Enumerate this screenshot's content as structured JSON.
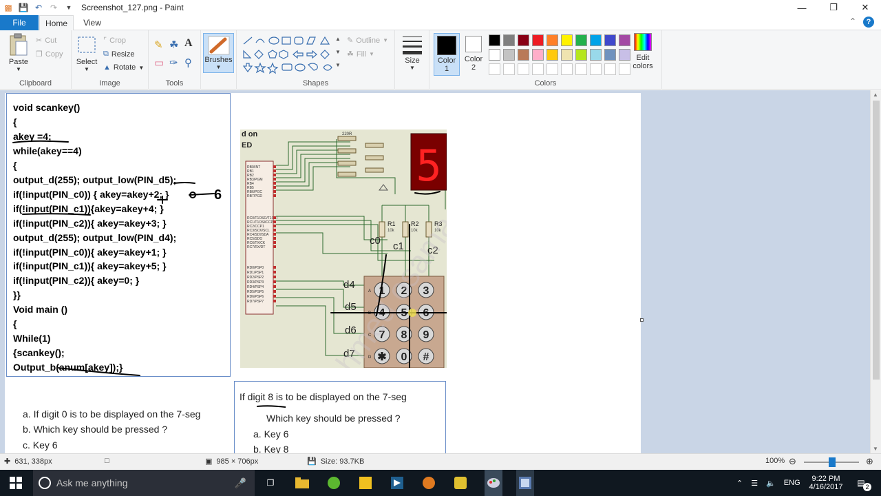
{
  "window": {
    "title": "Screenshot_127.png - Paint",
    "minimize": "—",
    "maximize": "❐",
    "close": "✕"
  },
  "tabs": {
    "file": "File",
    "home": "Home",
    "view": "View"
  },
  "ribbon": {
    "clipboard": {
      "label": "Clipboard",
      "paste": "Paste",
      "cut": "Cut",
      "copy": "Copy"
    },
    "image": {
      "label": "Image",
      "select": "Select",
      "crop": "Crop",
      "resize": "Resize",
      "rotate": "Rotate"
    },
    "tools": {
      "label": "Tools"
    },
    "brushes": {
      "label": "Brushes"
    },
    "shapes": {
      "label": "Shapes",
      "outline": "Outline",
      "fill": "Fill"
    },
    "size": {
      "label": "Size"
    },
    "colors": {
      "label": "Colors",
      "color1": "Color\n1",
      "color1_a": "Color",
      "color1_b": "1",
      "color2_a": "Color",
      "color2_b": "2",
      "edit_a": "Edit",
      "edit_b": "colors",
      "palette_row1": [
        "#000000",
        "#7f7f7f",
        "#880015",
        "#ed1c24",
        "#ff7f27",
        "#fff200",
        "#22b14c",
        "#00a2e8",
        "#3f48cc",
        "#a349a4"
      ],
      "palette_row2": [
        "#ffffff",
        "#c3c3c3",
        "#b97a57",
        "#ffaec9",
        "#ffc90e",
        "#efe4b0",
        "#b5e61d",
        "#99d9ea",
        "#7092be",
        "#c8bfe7"
      ]
    }
  },
  "code": {
    "lines": [
      "void scankey()",
      "{",
      "akey =4;",
      "while(akey==4)",
      "{",
      "output_d(255); output_low(PIN_d5);",
      "if(!input(PIN_c0)) { akey=akey+2; }",
      "if(!input(PIN_c1)){akey=akey+4; }",
      "if(!input(PIN_c2)){ akey=akey+3; }",
      "output_d(255); output_low(PIN_d4);",
      "if(!input(PIN_c0)){ akey=akey+1; }",
      "if(!input(PIN_c1)){ akey=akey+5; }",
      "if(!input(PIN_c2)){ akey=0; }",
      "}}",
      "Void main ()",
      "{",
      "While(1)",
      "{scankey();",
      "Output_b(anum[akey]);}"
    ],
    "annotation": "6"
  },
  "circuit": {
    "header_line1": "d on",
    "header_line2": "ED",
    "seg_digit": "5",
    "pins_left": [
      "RB0/INT",
      "RB1",
      "RB2",
      "RB3/PGM",
      "RB4",
      "RB5",
      "RB6/PGC",
      "RB7/PGD"
    ],
    "pins_c": [
      "RC0/T1OSO/T1CKI",
      "RC1/T1OSI/CCP2",
      "RC2/CCP1",
      "RC3/SCK/SCL",
      "RC4/SDI/SDA",
      "RC5/SDO",
      "RC6/TX/CK",
      "RC7/RX/DT"
    ],
    "pins_d": [
      "RD0/PSP0",
      "RD1/PSP1",
      "RD2/PSP2",
      "RD3/PSP3",
      "RD4/PSP4",
      "RD5/PSP5",
      "RD6/PSP6",
      "RD7/PSP7"
    ],
    "resistor_top": "220R",
    "r1": "R1",
    "r2": "R2",
    "r3": "R3",
    "rval": "10k",
    "c0": "c0",
    "c1": "c1",
    "c2": "c2",
    "d4": "d4",
    "d5": "d5",
    "d6": "d6",
    "d7": "d7",
    "row_letters": [
      "A",
      "B",
      "C",
      "D"
    ],
    "keys": [
      "1",
      "2",
      "3",
      "4",
      "5",
      "6",
      "7",
      "8",
      "9",
      "✱",
      "0",
      "#"
    ],
    "watermark": "ahmed osama"
  },
  "question_left": {
    "a": "a.  If digit 0 is  to be displayed on the 7-seg",
    "b": "b.  Which key should be pressed ?",
    "c": "c.  Key 6"
  },
  "question_right": {
    "title": "If digit 8 is  to be displayed on the 7-seg",
    "sub": "Which key should be pressed ?",
    "a": "a.  Key 6",
    "b": "b.  Key 8"
  },
  "status": {
    "cursor": "631, 338px",
    "selection": "",
    "dimensions": "985 × 706px",
    "size": "Size: 93.7KB",
    "zoom": "100%"
  },
  "taskbar": {
    "search_placeholder": "Ask me anything",
    "lang": "ENG",
    "time": "9:22 PM",
    "date": "4/16/2017",
    "notif": "2"
  }
}
